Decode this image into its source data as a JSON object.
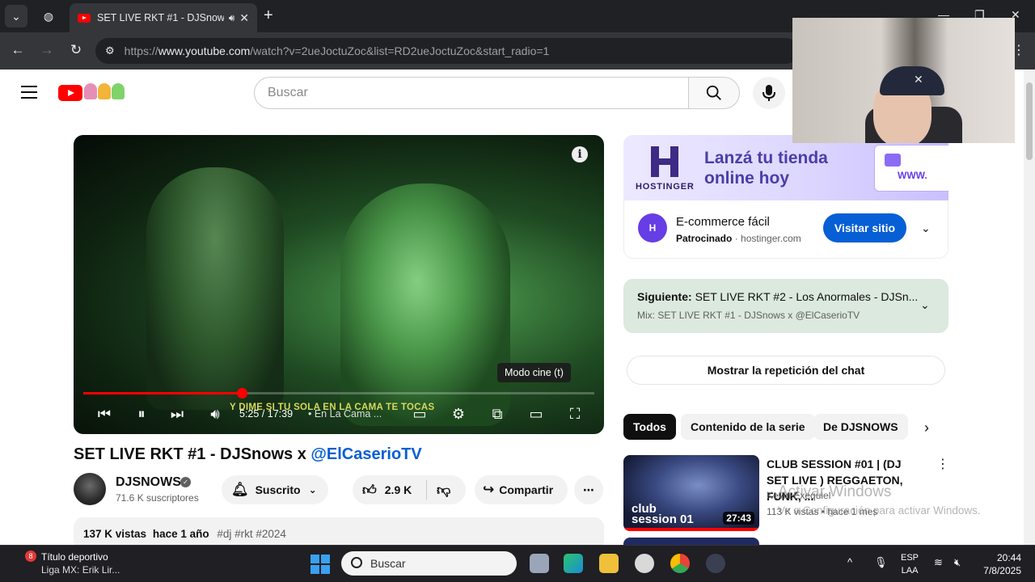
{
  "browser": {
    "tab_title": "SET LIVE RKT #1 - DJSnows",
    "url_prefix": "https://",
    "url_host": "www.youtube.com",
    "url_path": "/watch?v=2ueJoctuZoc&list=RD2ueJoctuZoc&start_radio=1"
  },
  "masthead": {
    "search_placeholder": "Buscar"
  },
  "player": {
    "tooltip": "Modo cine (t)",
    "subtitle": "Y DIME SI TU SOLA EN LA CAMA TE TOCAS",
    "time": "5:25 / 17:39",
    "chapter": "• En La Cama ...",
    "progress": 0.31
  },
  "video": {
    "title_prefix": "SET LIVE RKT #1 - DJSnows x ",
    "title_link": "@ElCaserioTV",
    "channel": "DJSNOWS",
    "subscribers": "71.6 K suscriptores",
    "subscribe_label": "Suscrito",
    "likes": "2.9 K",
    "share_label": "Compartir",
    "views": "137 K vistas",
    "age": "hace 1 año",
    "tags": "#dj #rkt #2024"
  },
  "ad": {
    "brand": "HOSTINGER",
    "headline": "Lanzá tu tienda online hoy",
    "window_text": "WWW.",
    "title": "E-commerce fácil",
    "sponsored": "Patrocinado",
    "domain": "hostinger.com",
    "cta": "Visitar sitio"
  },
  "next_up": {
    "label": "Siguiente:",
    "title": "SET LIVE RKT #2 - Los Anormales - DJSn...",
    "mix": "Mix: SET LIVE RKT #1 - DJSnows x @ElCaserioTV"
  },
  "chat_replay": "Mostrar la repetición del chat",
  "chips": [
    "Todos",
    "Contenido de la serie",
    "De DJSNOWS"
  ],
  "recommendation": {
    "title": "CLUB SESSION #01 | (DJ SET LIVE ) REGGAETON, FUNK, ...",
    "channel": "Kevin Exequiel",
    "meta": "113 K vistas • hace 1 mes",
    "duration": "27:43",
    "thumb_text_1": "club",
    "thumb_text_2": "session 01"
  },
  "windows_watermark": {
    "title": "Activar Windows",
    "subtitle": "Ve a Configuración para activar Windows."
  },
  "taskbar": {
    "news_count": "8",
    "news_title": "Título deportivo",
    "news_sub": "Liga MX: Erik Lir...",
    "search": "Buscar",
    "lang_1": "ESP",
    "lang_2": "LAA",
    "time": "20:44",
    "date": "7/8/2025"
  }
}
